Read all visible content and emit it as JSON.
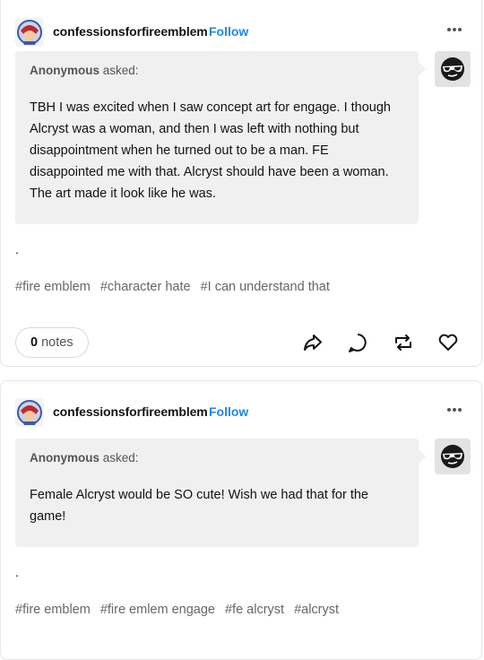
{
  "posts": [
    {
      "blog_name": "confessionsforfireemblem",
      "follow_label": "Follow",
      "asker_name": "Anonymous",
      "asked_label": "asked:",
      "question": "TBH I was excited when I saw concept art for engage. I though Alcryst was a woman, and then I was left with nothing but disappointment when he turned out to be a man. FE disappointed me with that. Alcryst should have been a woman. The art made it look like he was.",
      "answer": ".",
      "tags": [
        "#fire emblem",
        "#character hate",
        "#I can understand that"
      ],
      "notes_count": "0",
      "notes_label": "notes"
    },
    {
      "blog_name": "confessionsforfireemblem",
      "follow_label": "Follow",
      "asker_name": "Anonymous",
      "asked_label": "asked:",
      "question": "Female Alcryst would be SO cute! Wish we had that for the game!",
      "answer": ".",
      "tags": [
        "#fire emblem",
        "#fire emlem engage",
        "#fe alcryst",
        "#alcryst"
      ]
    }
  ],
  "colors": {
    "follow": "#1e88e5",
    "bubble": "#f0f0f0",
    "tag": "#666666"
  },
  "icons": [
    "more-icon",
    "share-icon",
    "reply-icon",
    "reblog-icon",
    "like-icon",
    "anonymous-sunglasses-icon"
  ]
}
